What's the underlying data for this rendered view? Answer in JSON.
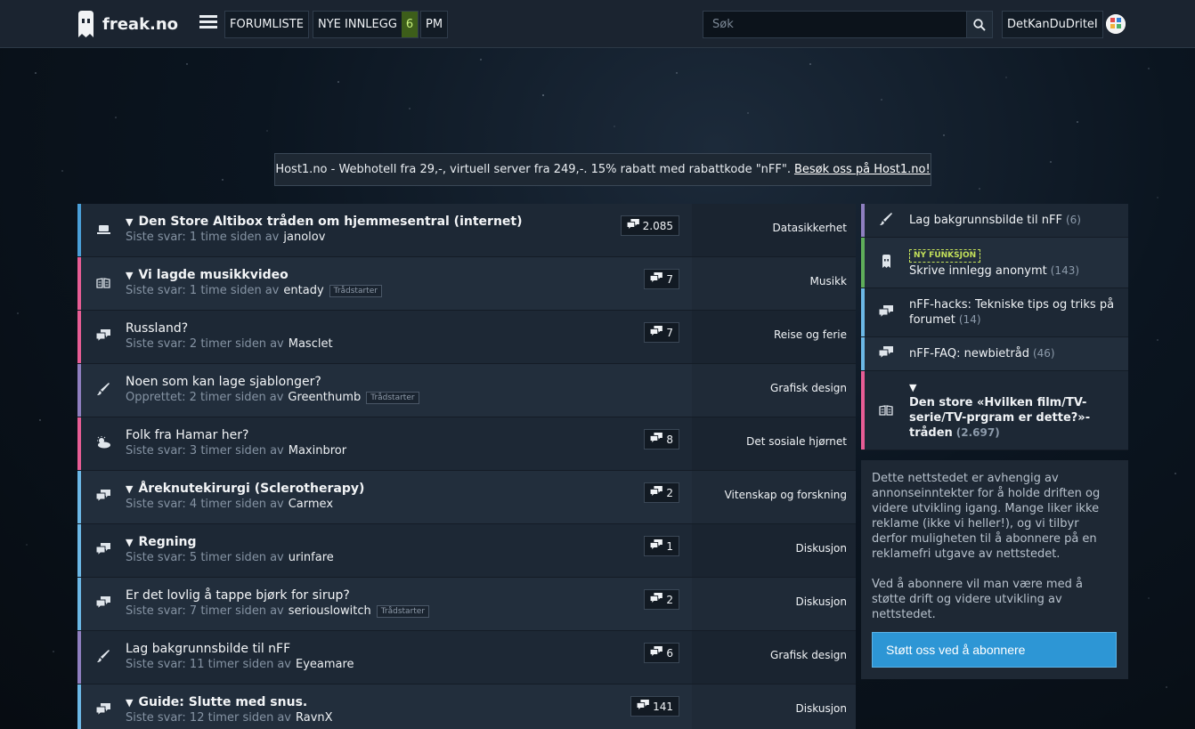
{
  "header": {
    "logo_text": "freak.no",
    "nav": {
      "forumliste": "FORUMLISTE",
      "nye_innlegg": "NYE INNLEGG",
      "nye_count": "6",
      "pm": "PM"
    },
    "search_placeholder": "Søk",
    "username": "DetKanDuDriteI"
  },
  "ad": {
    "text": "Host1.no - Webhotell fra 29,-, virtuell server fra 249,-. 15% rabatt med rabattkode \"nFF\".",
    "link": "Besøk oss på Host1.no!"
  },
  "threads": [
    {
      "title": "Den Store Altibox tråden om hjemmesentral (internet)",
      "bold": true,
      "meta": "Siste svar: 1 time siden",
      "by": "av",
      "user": "janolov",
      "starter": "",
      "replies": "2.085",
      "category": "Datasikkerhet",
      "color": "#4a9fd8",
      "icon": "laptop-icon"
    },
    {
      "title": "Vi lagde musikkvideo",
      "bold": true,
      "meta": "Siste svar: 1 time siden",
      "by": "av",
      "user": "entady",
      "starter": "Trådstarter",
      "replies": "7",
      "category": "Musikk",
      "color": "#e85d95",
      "icon": "book-icon"
    },
    {
      "title": "Russland?",
      "bold": false,
      "meta": "Siste svar: 2 timer siden",
      "by": "av",
      "user": "Masclet",
      "starter": "",
      "replies": "7",
      "category": "Reise og ferie",
      "color": "#e85d95",
      "icon": "chat-icon"
    },
    {
      "title": "Noen som kan lage sjablonger?",
      "bold": false,
      "meta": "Opprettet: 2 timer siden",
      "by": "av",
      "user": "Greenthumb",
      "starter": "Trådstarter",
      "replies": "",
      "category": "Grafisk design",
      "color": "#8f7fc0",
      "icon": "brush-icon"
    },
    {
      "title": "Folk fra Hamar her?",
      "bold": false,
      "meta": "Siste svar: 3 timer siden",
      "by": "av",
      "user": "Maxinbror",
      "starter": "",
      "replies": "8",
      "category": "Det sosiale hjørnet",
      "color": "#e85d95",
      "icon": "weather-icon"
    },
    {
      "title": "Åreknutekirurgi (Sclerotherapy)",
      "bold": true,
      "meta": "Siste svar: 4 timer siden",
      "by": "av",
      "user": "Carmex",
      "starter": "",
      "replies": "2",
      "category": "Vitenskap og forskning",
      "color": "#6cb8e6",
      "icon": "chat-icon"
    },
    {
      "title": "Regning",
      "bold": true,
      "meta": "Siste svar: 5 timer siden",
      "by": "av",
      "user": "urinfare",
      "starter": "",
      "replies": "1",
      "category": "Diskusjon",
      "color": "#6cb8e6",
      "icon": "chat-icon"
    },
    {
      "title": "Er det lovlig å tappe bjørk for sirup?",
      "bold": false,
      "meta": "Siste svar: 7 timer siden",
      "by": "av",
      "user": "seriouslowitch",
      "starter": "Trådstarter",
      "replies": "2",
      "category": "Diskusjon",
      "color": "#6cb8e6",
      "icon": "chat-icon"
    },
    {
      "title": "Lag bakgrunnsbilde til nFF",
      "bold": false,
      "meta": "Siste svar: 11 timer siden",
      "by": "av",
      "user": "Eyeamare",
      "starter": "",
      "replies": "6",
      "category": "Grafisk design",
      "color": "#8f7fc0",
      "icon": "brush-icon"
    },
    {
      "title": "Guide: Slutte med snus.",
      "bold": true,
      "meta": "Siste svar: 12 timer siden",
      "by": "av",
      "user": "RavnX",
      "starter": "",
      "replies": "141",
      "category": "Diskusjon",
      "color": "#6cb8e6",
      "icon": "chat-icon"
    }
  ],
  "sidebar": {
    "items": [
      {
        "label": "Lag bakgrunnsbilde til nFF",
        "count": "(6)",
        "color": "#8f7fc0",
        "icon": "brush-icon",
        "new": ""
      },
      {
        "label": "Skrive innlegg anonymt",
        "count": "(143)",
        "color": "#5fae5a",
        "icon": "ghost-icon",
        "new": "NY FUNKSJON"
      },
      {
        "label": "nFF-hacks: Tekniske tips og triks på forumet",
        "count": "(14)",
        "color": "#6cb8e6",
        "icon": "chat-icon",
        "new": ""
      },
      {
        "label": "nFF-FAQ: newbietråd",
        "count": "(46)",
        "color": "#6cb8e6",
        "icon": "chat-icon",
        "new": ""
      },
      {
        "label": "Den store «Hvilken film/TV-serie/TV-prgram er dette?»-tråden",
        "count": "(2.697)",
        "color": "#e85d95",
        "icon": "book-icon",
        "new": ""
      }
    ],
    "support_p1": "Dette nettstedet er avhengig av annonseinntekter for å holde driften og videre utvikling igang. Mange liker ikke reklame (ikke vi heller!), og vi tilbyr derfor muligheten til å abonnere på en reklamefri utgave av nettstedet.",
    "support_p2": "Ved å abonnere vil man være med å støtte drift og videre utvikling av nettstedet.",
    "subscribe_label": "Støtt oss ved å abonnere"
  }
}
